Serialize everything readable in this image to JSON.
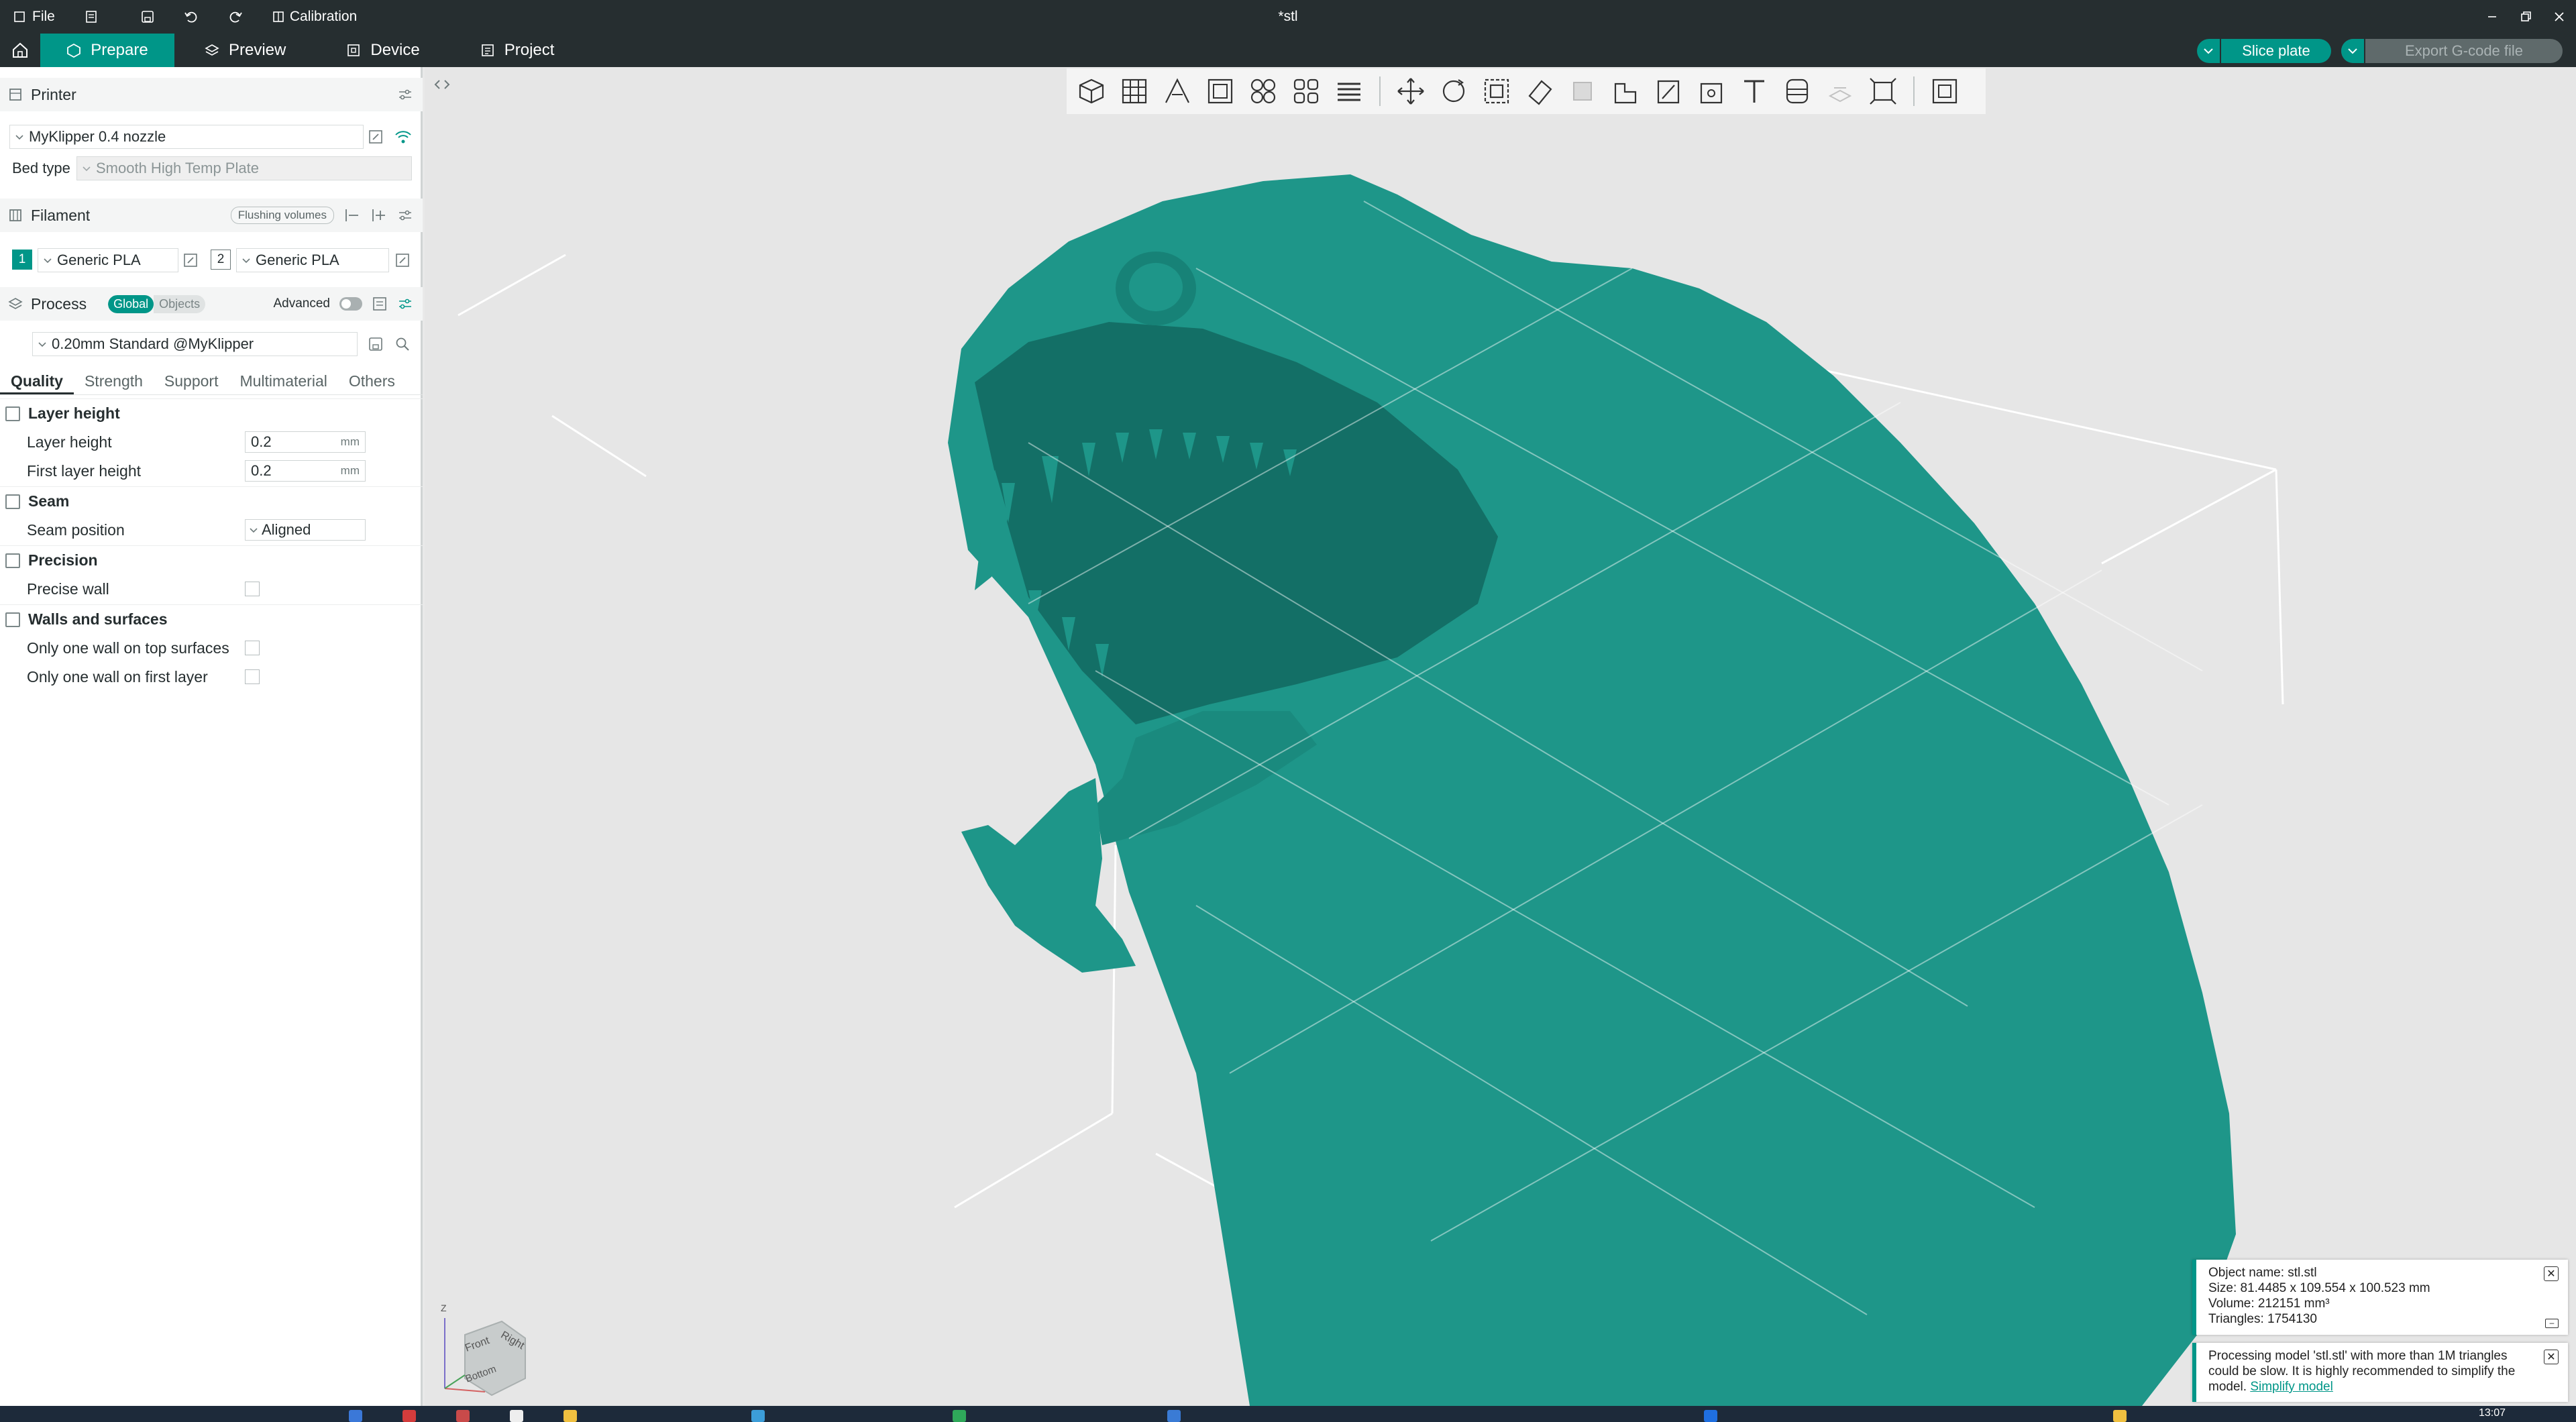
{
  "window": {
    "file_menu": "File",
    "calibration_label": "Calibration",
    "doc_title": "*stl"
  },
  "tabs": [
    {
      "label": "Prepare"
    },
    {
      "label": "Preview"
    },
    {
      "label": "Device"
    },
    {
      "label": "Project"
    }
  ],
  "actions": {
    "slice_label": "Slice plate",
    "export_label": "Export G-code file"
  },
  "printer": {
    "section_title": "Printer",
    "selected": "MyKlipper 0.4 nozzle",
    "bed_type_label": "Bed type",
    "bed_type_value": "Smooth High Temp Plate"
  },
  "filament": {
    "section_title": "Filament",
    "flushing_label": "Flushing volumes",
    "slots": [
      {
        "index": "1",
        "name": "Generic PLA",
        "color": "#009688"
      },
      {
        "index": "2",
        "name": "Generic PLA",
        "color": "#ffffff"
      }
    ]
  },
  "process": {
    "section_title": "Process",
    "global_label": "Global",
    "objects_label": "Objects",
    "advanced_label": "Advanced",
    "preset": "0.20mm Standard @MyKlipper",
    "subtabs": [
      "Quality",
      "Strength",
      "Support",
      "Multimaterial",
      "Others"
    ]
  },
  "quality": {
    "layer_height_group": "Layer height",
    "layer_height_label": "Layer height",
    "layer_height_value": "0.2",
    "first_layer_height_label": "First layer height",
    "first_layer_height_value": "0.2",
    "unit": "mm",
    "seam_group": "Seam",
    "seam_position_label": "Seam position",
    "seam_position_value": "Aligned",
    "precision_group": "Precision",
    "precise_wall_label": "Precise wall",
    "walls_group": "Walls and surfaces",
    "one_wall_top_label": "Only one wall on top surfaces",
    "one_wall_first_label": "Only one wall on first layer"
  },
  "view_cube": {
    "z": "Z",
    "front": "Front",
    "right": "Right",
    "bottom": "Bottom"
  },
  "notifications": {
    "object_info": {
      "name": "Object name: stl.stl",
      "size": "Size: 81.4485 x 109.554 x 100.523 mm",
      "volume": "Volume: 212151 mm³",
      "triangles": "Triangles: 1754130"
    },
    "warning": {
      "text": "Processing model 'stl.stl' with more than 1M triangles could be slow. It is highly recommended to simplify the model.",
      "link": "Simplify model"
    }
  },
  "taskbar": {
    "clock": "13:07"
  },
  "colors": {
    "accent": "#009688",
    "model": "#1e9689",
    "titlebar": "#262e30"
  }
}
